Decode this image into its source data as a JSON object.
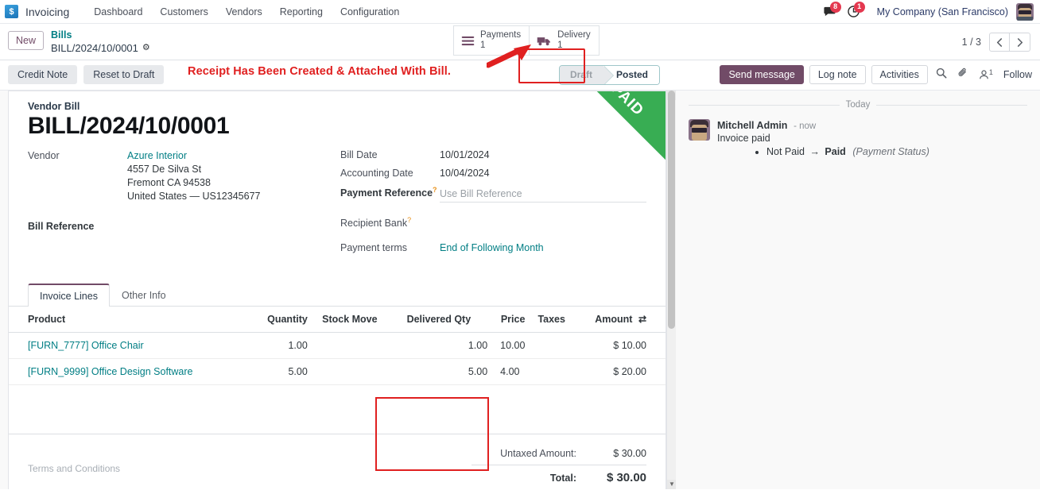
{
  "navbar": {
    "app_name": "Invoicing",
    "brand_icon": "invoicing-app-icon",
    "menu": [
      "Dashboard",
      "Customers",
      "Vendors",
      "Reporting",
      "Configuration"
    ],
    "messages_icon": "chat-bubble-icon",
    "messages_count": "8",
    "activities_icon": "clock-icon",
    "activities_count": "1",
    "company": "My Company (San Francisco)",
    "avatar": "user-avatar"
  },
  "control_panel": {
    "new_label": "New",
    "breadcrumb_parent": "Bills",
    "breadcrumb_current": "BILL/2024/10/0001",
    "gear_icon": "gear-icon",
    "smart_buttons": [
      {
        "icon": "list-lines-icon",
        "label": "Payments",
        "value": "1",
        "highlighted": false
      },
      {
        "icon": "truck-icon",
        "label": "Delivery",
        "value": "1",
        "highlighted": true
      }
    ],
    "pager_text": "1 / 3",
    "prev_icon": "chevron-left-icon",
    "next_icon": "chevron-right-icon"
  },
  "action_row": {
    "buttons": [
      "Credit Note",
      "Reset to Draft"
    ],
    "annotation": "Receipt Has Been Created & Attached With Bill.",
    "status_steps": [
      {
        "label": "Draft",
        "active": false
      },
      {
        "label": "Posted",
        "active": true
      }
    ],
    "chatter_buttons": [
      "Send message",
      "Log note",
      "Activities"
    ],
    "search_icon": "magnifier-icon",
    "attachment_icon": "paperclip-icon",
    "followers_icon": "user-followers-icon",
    "followers_count": "1",
    "follow_label": "Follow"
  },
  "form": {
    "ribbon": "PAID",
    "doc_type": "Vendor Bill",
    "title": "BILL/2024/10/0001",
    "vendor_label": "Vendor",
    "vendor_name": "Azure Interior",
    "vendor_address": [
      "4557 De Silva St",
      "Fremont CA 94538",
      "United States — US12345677"
    ],
    "bill_reference_label": "Bill Reference",
    "bill_date_label": "Bill Date",
    "bill_date_value": "10/01/2024",
    "accounting_date_label": "Accounting Date",
    "accounting_date_value": "10/04/2024",
    "payment_reference_label": "Payment Reference",
    "payment_reference_placeholder": "Use Bill Reference",
    "recipient_bank_label": "Recipient Bank",
    "recipient_bank_value": "",
    "payment_terms_label": "Payment terms",
    "payment_terms_value": "End of Following Month"
  },
  "notebook": {
    "tabs": [
      {
        "label": "Invoice Lines",
        "active": true
      },
      {
        "label": "Other Info",
        "active": false
      }
    ],
    "columns": [
      "Product",
      "Quantity",
      "Stock Move",
      "Delivered Qty",
      "Price",
      "Taxes",
      "Amount"
    ],
    "options_icon": "column-options-icon",
    "rows": [
      {
        "product": "[FURN_7777] Office Chair",
        "quantity": "1.00",
        "stock_move": "",
        "delivered_qty": "1.00",
        "price": "10.00",
        "taxes": "",
        "amount": "$ 10.00"
      },
      {
        "product": "[FURN_9999] Office Design Software",
        "quantity": "5.00",
        "stock_move": "",
        "delivered_qty": "5.00",
        "price": "4.00",
        "taxes": "",
        "amount": "$ 20.00"
      }
    ]
  },
  "footer": {
    "terms_placeholder": "Terms and Conditions",
    "untaxed_label": "Untaxed Amount:",
    "untaxed_value": "$ 30.00",
    "total_label": "Total:",
    "total_value": "$ 30.00"
  },
  "chatter": {
    "today_label": "Today",
    "message": {
      "author": "Mitchell Admin",
      "time": "- now",
      "text": "Invoice paid",
      "tracking_old": "Not Paid",
      "tracking_arrow": "→",
      "tracking_new": "Paid",
      "tracking_field": "(Payment Status)"
    }
  },
  "colors": {
    "brand": "#714B67",
    "link": "#017e84",
    "paid_ribbon": "#28a745",
    "annotation_red": "#e02020",
    "badge_red": "#e4384f"
  }
}
